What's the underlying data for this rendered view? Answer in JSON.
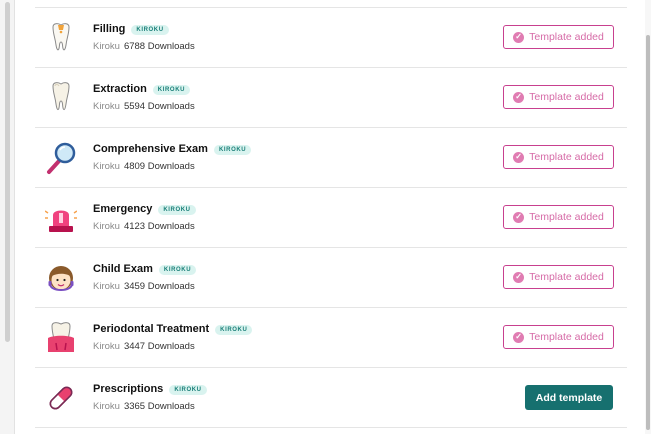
{
  "templates": [
    {
      "name": "Filling",
      "badge": "KIROKU",
      "author": "Kiroku",
      "downloads": "6788 Downloads",
      "button": "Template added",
      "icon": "tooth-filling-icon"
    },
    {
      "name": "Extraction",
      "badge": "KIROKU",
      "author": "Kiroku",
      "downloads": "5594 Downloads",
      "button": "Template added",
      "icon": "tooth-extraction-icon"
    },
    {
      "name": "Comprehensive Exam",
      "badge": "KIROKU",
      "author": "Kiroku",
      "downloads": "4809 Downloads",
      "button": "Template added",
      "icon": "magnifier-icon"
    },
    {
      "name": "Emergency",
      "badge": "KIROKU",
      "author": "Kiroku",
      "downloads": "4123 Downloads",
      "button": "Template added",
      "icon": "siren-icon"
    },
    {
      "name": "Child Exam",
      "badge": "KIROKU",
      "author": "Kiroku",
      "downloads": "3459 Downloads",
      "button": "Template added",
      "icon": "child-icon"
    },
    {
      "name": "Periodontal Treatment",
      "badge": "KIROKU",
      "author": "Kiroku",
      "downloads": "3447 Downloads",
      "button": "Template added",
      "icon": "tooth-gum-icon"
    },
    {
      "name": "Prescriptions",
      "badge": "KIROKU",
      "author": "Kiroku",
      "downloads": "3365 Downloads",
      "button": "Add template",
      "icon": "pill-icon"
    }
  ],
  "check_mark": "✓",
  "colors": {
    "badge_bg": "#d9f3ef",
    "badge_text": "#1a7f78",
    "added_border": "#c8408f",
    "added_text": "#d66ba7",
    "add_bg": "#16706f"
  }
}
